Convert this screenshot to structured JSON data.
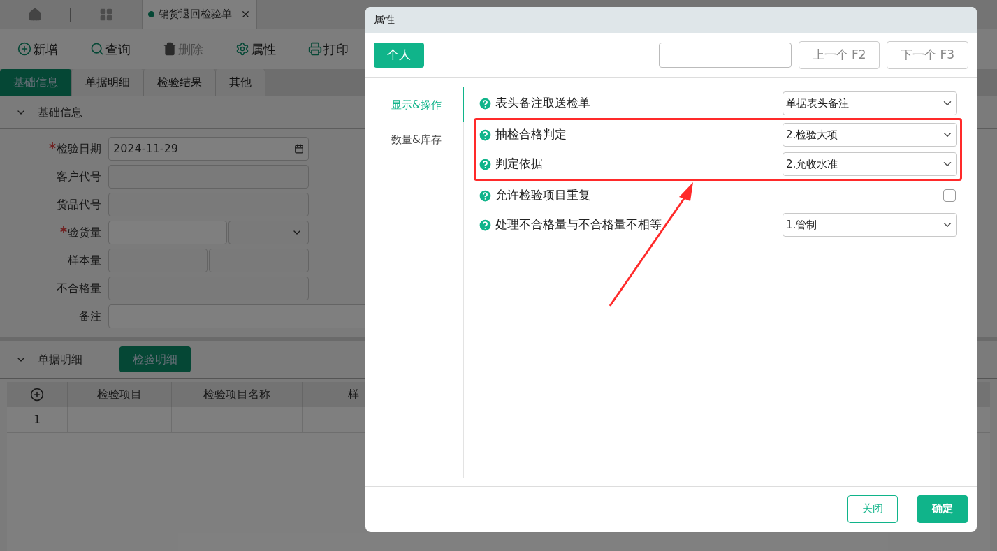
{
  "tab_bar": {
    "tabs": [
      {
        "label": "销货退回检验单",
        "selected": true
      }
    ]
  },
  "toolbar": [
    {
      "kind": "add",
      "label": "新增",
      "disabled": false
    },
    {
      "kind": "search",
      "label": "查询",
      "disabled": false
    },
    {
      "kind": "delete",
      "label": "删除",
      "disabled": true
    },
    {
      "kind": "settings",
      "label": "属性",
      "disabled": false
    },
    {
      "kind": "print",
      "label": "打印",
      "disabled": false
    }
  ],
  "section_tabs": [
    {
      "label": "基础信息",
      "selected": true
    },
    {
      "label": "单据明细",
      "selected": false
    },
    {
      "label": "检验结果",
      "selected": false
    },
    {
      "label": "其他",
      "selected": false
    }
  ],
  "basic_section": {
    "title": "基础信息",
    "fields": [
      {
        "kind": "date",
        "label": "检验日期",
        "required": true,
        "value": "2024-11-29"
      },
      {
        "kind": "text",
        "label": "客户代号",
        "required": false
      },
      {
        "kind": "text",
        "label": "货品代号",
        "required": false
      },
      {
        "kind": "split_select",
        "label": "验货量",
        "required": true
      },
      {
        "kind": "split",
        "label": "样本量",
        "required": false
      },
      {
        "kind": "text",
        "label": "不合格量",
        "required": false
      },
      {
        "kind": "wide",
        "label": "备注",
        "required": false
      }
    ]
  },
  "detail_section": {
    "title": "单据明细",
    "button": "检验明细",
    "table": {
      "columns": [
        "检验项目",
        "检验项目名称",
        "样"
      ],
      "rows": [
        {
          "index": "1"
        }
      ]
    }
  },
  "dialog": {
    "title": "属性",
    "scope_button": "个人",
    "prev_button": "上一个 F2",
    "next_button": "下一个 F3",
    "nav": [
      {
        "label": "显示&操作",
        "selected": true
      },
      {
        "label": "数量&库存",
        "selected": false
      }
    ],
    "settings": [
      {
        "kind": "select",
        "label": "表头备注取送检单",
        "value": "单据表头备注",
        "highlighted": false
      },
      {
        "kind": "select",
        "label": "抽检合格判定",
        "value": "2.检验大项",
        "highlighted": true
      },
      {
        "kind": "select",
        "label": "判定依据",
        "value": "2.允收水准",
        "highlighted": true
      },
      {
        "kind": "checkbox",
        "label": "允许检验项目重复",
        "checked": false,
        "highlighted": false
      },
      {
        "kind": "select",
        "label": "处理不合格量与不合格量不相等",
        "value": "1.管制",
        "highlighted": false
      }
    ],
    "close_button": "关闭",
    "ok_button": "确定"
  }
}
